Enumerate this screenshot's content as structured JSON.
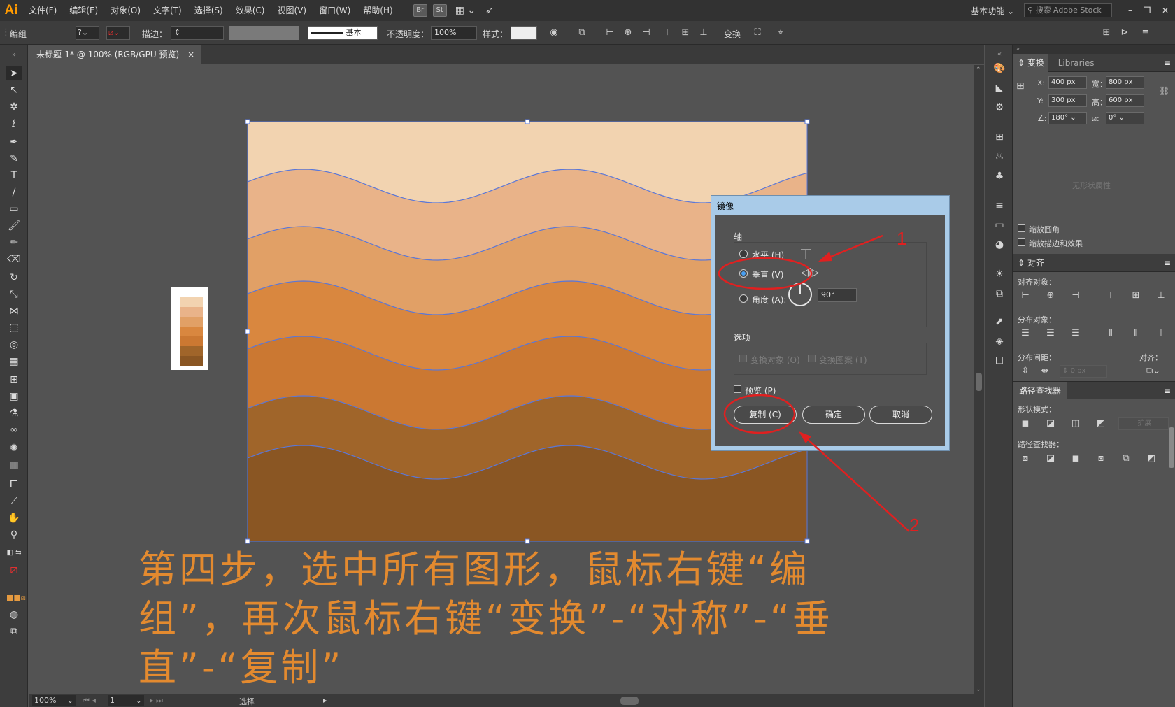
{
  "app": {
    "logo": "Ai",
    "accent": "#ff9a00"
  },
  "menu": [
    "文件(F)",
    "编辑(E)",
    "对象(O)",
    "文字(T)",
    "选择(S)",
    "效果(C)",
    "视图(V)",
    "窗口(W)",
    "帮助(H)"
  ],
  "menu_badges": [
    "Br",
    "St"
  ],
  "workspace": {
    "label": "基本功能",
    "search_placeholder": "搜索 Adobe Stock"
  },
  "control_bar": {
    "group_label": "编组",
    "stroke_label": "描边：",
    "stroke_style": "基本",
    "opacity_label": "不透明度：",
    "opacity_value": "100%",
    "style_label": "样式：",
    "transform_label": "变换"
  },
  "document_tab": {
    "title": "未标题-1* @ 100% (RGB/GPU 预览)",
    "close": "×"
  },
  "status_bar": {
    "zoom": "100%",
    "page": "1",
    "tool": "选择"
  },
  "transform_panel": {
    "tabs": [
      "变换",
      "Libraries"
    ],
    "x_label": "X:",
    "x_value": "400 px",
    "y_label": "Y:",
    "y_value": "300 px",
    "w_label": "宽：",
    "w_value": "800 px",
    "h_label": "高：",
    "h_value": "600 px",
    "angle_value": "180°",
    "shear_value": "0°",
    "no_shape": "无形状属性",
    "scale_corners": "缩放圆角",
    "scale_strokes": "缩放描边和效果"
  },
  "align_panel": {
    "title": "对齐",
    "align_objects": "对齐对象：",
    "distribute_objects": "分布对象：",
    "distribute_spacing": "分布间距：",
    "align_to": "对齐：",
    "spacing_value": "0 px"
  },
  "pathfinder_panel": {
    "title": "路径查找器",
    "shape_modes": "形状模式：",
    "pathfinders": "路径查找器：",
    "expand": "扩展"
  },
  "dialog": {
    "title": "镜像",
    "axis_label": "轴",
    "horizontal": "水平 (H)",
    "vertical": "垂直 (V)",
    "angle_label": "角度 (A):",
    "angle_value": "90°",
    "options_label": "选项",
    "transform_objects": "变换对象 (O)",
    "transform_patterns": "变换图案 (T)",
    "preview": "预览 (P)",
    "copy": "复制 (C)",
    "ok": "确定",
    "cancel": "取消",
    "selected_axis": "vertical"
  },
  "annotations": {
    "marker_1": "1",
    "marker_2": "2",
    "color": "#e02020"
  },
  "tutorial_text": "第四步，选中所有图形，鼠标右键“编组”，再次鼠标右键“变换”-“对称”-“垂直”-“复制”",
  "artwork": {
    "band_colors": [
      "#f2d3b0",
      "#e9b389",
      "#e1a066",
      "#d9873f",
      "#cb7832",
      "#a0652a",
      "#8a5623"
    ],
    "swatch_colors": [
      "#f2d3b0",
      "#e9b389",
      "#e1a066",
      "#d9873f",
      "#cb7832",
      "#a0652a",
      "#8a5623"
    ],
    "outline_color": "#5a77d8"
  }
}
